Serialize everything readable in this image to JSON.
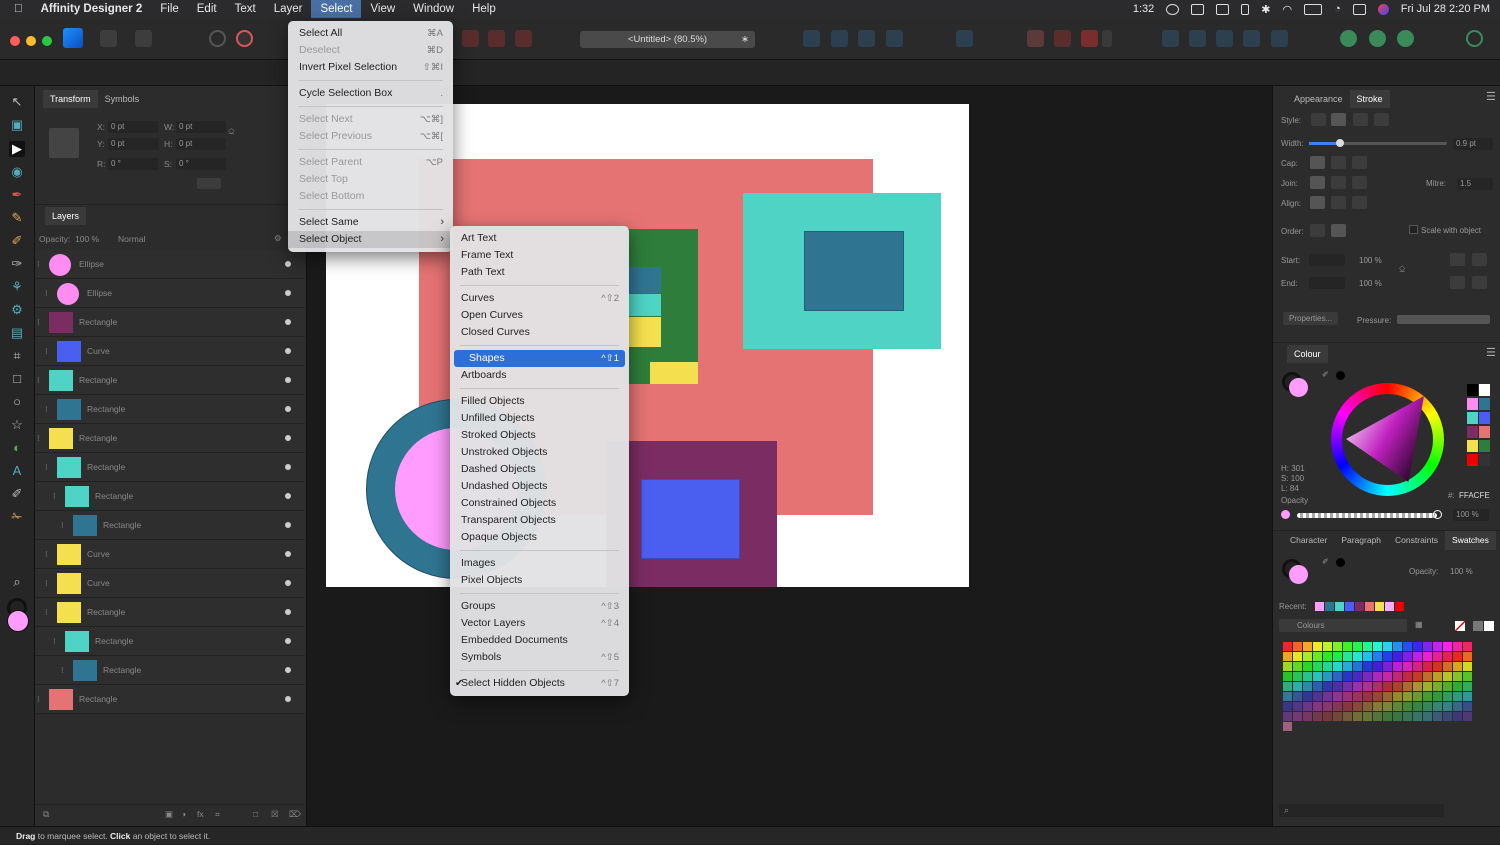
{
  "menubar": {
    "app_name": "Affinity Designer 2",
    "items": [
      "File",
      "Edit",
      "Text",
      "Layer",
      "Select",
      "View",
      "Window",
      "Help"
    ],
    "active": "Select",
    "status": {
      "battery_time": "1:32",
      "datetime": "Fri Jul 28  2:20 PM"
    }
  },
  "toolbar": {
    "document_tab": "<Untitled> (80.5%)"
  },
  "transform_panel": {
    "tabs": [
      "Transform",
      "Symbols"
    ],
    "x_label": "X:",
    "x_value": "0 pt",
    "y_label": "Y:",
    "y_value": "0 pt",
    "w_label": "W:",
    "w_value": "0 pt",
    "h_label": "H:",
    "h_value": "0 pt",
    "r_label": "R:",
    "r_value": "0 °",
    "s_label": "S:",
    "s_value": "0 °"
  },
  "layers_panel": {
    "title": "Layers",
    "opacity_label": "Opacity:",
    "opacity_value": "100 %",
    "blend_mode": "Normal",
    "rows": [
      {
        "name": "Ellipse",
        "color": "#ff8cf0",
        "shape": "circle"
      },
      {
        "name": "Ellipse",
        "color": "#ff8cf0",
        "shape": "circle"
      },
      {
        "name": "Rectangle",
        "color": "#7b2c62",
        "shape": "rect"
      },
      {
        "name": "Curve",
        "color": "#4a5ff0",
        "shape": "rect"
      },
      {
        "name": "Rectangle",
        "color": "#4ed3c4",
        "shape": "rect"
      },
      {
        "name": "Rectangle",
        "color": "#2f7592",
        "shape": "rect"
      },
      {
        "name": "Rectangle",
        "color": "#f4e04f",
        "shape": "rect"
      },
      {
        "name": "Rectangle",
        "color": "#4ed3c4",
        "shape": "rect"
      },
      {
        "name": "Rectangle",
        "color": "#4ed3c4",
        "shape": "rect"
      },
      {
        "name": "Rectangle",
        "color": "#2f7592",
        "shape": "rect"
      },
      {
        "name": "Curve",
        "color": "#f4e04f",
        "shape": "rect"
      },
      {
        "name": "Curve",
        "color": "#f4e04f",
        "shape": "rect"
      },
      {
        "name": "Rectangle",
        "color": "#f4e04f",
        "shape": "rect"
      },
      {
        "name": "Rectangle",
        "color": "#4ed3c4",
        "shape": "rect"
      },
      {
        "name": "Rectangle",
        "color": "#2f7592",
        "shape": "rect"
      },
      {
        "name": "Rectangle",
        "color": "#e57373",
        "shape": "rect"
      }
    ]
  },
  "select_menu": {
    "groups": [
      [
        {
          "label": "Select All",
          "shortcut": "⌘A",
          "disabled": false
        },
        {
          "label": "Deselect",
          "shortcut": "⌘D",
          "disabled": true
        },
        {
          "label": "Invert Pixel Selection",
          "shortcut": "⇧⌘I",
          "disabled": false
        }
      ],
      [
        {
          "label": "Cycle Selection Box",
          "shortcut": ".",
          "disabled": false
        }
      ],
      [
        {
          "label": "Select Next",
          "shortcut": "⌥⌘]",
          "disabled": true
        },
        {
          "label": "Select Previous",
          "shortcut": "⌥⌘[",
          "disabled": true
        }
      ],
      [
        {
          "label": "Select Parent",
          "shortcut": "⌥P",
          "disabled": true
        },
        {
          "label": "Select Top",
          "shortcut": "",
          "disabled": true
        },
        {
          "label": "Select Bottom",
          "shortcut": "",
          "disabled": true
        }
      ],
      [
        {
          "label": "Select Same",
          "shortcut": "",
          "disabled": false,
          "submenu": true
        },
        {
          "label": "Select Object",
          "shortcut": "",
          "disabled": false,
          "submenu": true,
          "open": true
        }
      ]
    ]
  },
  "select_object_submenu": {
    "groups": [
      [
        {
          "label": "Art Text",
          "shortcut": ""
        },
        {
          "label": "Frame Text",
          "shortcut": ""
        },
        {
          "label": "Path Text",
          "shortcut": ""
        }
      ],
      [
        {
          "label": "Curves",
          "shortcut": "^⇧2"
        },
        {
          "label": "Open Curves",
          "shortcut": ""
        },
        {
          "label": "Closed Curves",
          "shortcut": ""
        }
      ],
      [
        {
          "label": "Shapes",
          "shortcut": "^⇧1",
          "highlighted": true
        },
        {
          "label": "Artboards",
          "shortcut": ""
        }
      ],
      [
        {
          "label": "Filled Objects",
          "shortcut": ""
        },
        {
          "label": "Unfilled Objects",
          "shortcut": ""
        },
        {
          "label": "Stroked Objects",
          "shortcut": ""
        },
        {
          "label": "Unstroked Objects",
          "shortcut": ""
        },
        {
          "label": "Dashed Objects",
          "shortcut": ""
        },
        {
          "label": "Undashed Objects",
          "shortcut": ""
        },
        {
          "label": "Constrained Objects",
          "shortcut": ""
        },
        {
          "label": "Transparent Objects",
          "shortcut": ""
        },
        {
          "label": "Opaque Objects",
          "shortcut": ""
        }
      ],
      [
        {
          "label": "Images",
          "shortcut": ""
        },
        {
          "label": "Pixel Objects",
          "shortcut": ""
        }
      ],
      [
        {
          "label": "Groups",
          "shortcut": "^⇧3"
        },
        {
          "label": "Vector Layers",
          "shortcut": "^⇧4"
        },
        {
          "label": "Embedded Documents",
          "shortcut": ""
        },
        {
          "label": "Symbols",
          "shortcut": "^⇧5"
        }
      ],
      [
        {
          "label": "Select Hidden Objects",
          "shortcut": "^⇧7",
          "checked": true
        }
      ]
    ]
  },
  "stroke_panel": {
    "tabs": [
      "Appearance",
      "Stroke"
    ],
    "style_label": "Style:",
    "width_label": "Width:",
    "width_value": "0.9 pt",
    "cap_label": "Cap:",
    "join_label": "Join:",
    "mitre_label": "Mitre:",
    "mitre_value": "1.5",
    "align_label": "Align:",
    "order_label": "Order:",
    "scale_label": "Scale with object",
    "start_label": "Start:",
    "end_label": "End:",
    "start_pct": "100 %",
    "end_pct": "100 %",
    "properties_btn": "Properties...",
    "pressure_label": "Pressure:"
  },
  "colour_panel": {
    "title": "Colour",
    "h": "H: 301",
    "s": "S: 100",
    "l": "L: 84",
    "opacity_label": "Opacity",
    "hex_label": "#:",
    "hex_value": "FFACFE",
    "opacity_value": "100 %",
    "fill_color": "#ff9cfe"
  },
  "swatches_panel": {
    "tabs": [
      "Character",
      "Paragraph",
      "Constraints",
      "Swatches"
    ],
    "opacity_label": "Opacity:",
    "opacity_value": "100 %",
    "recent_label": "Recent:",
    "palette_name": "Colours"
  },
  "statusbar": {
    "drag": "Drag",
    "t1": " to marquee select. ",
    "click": "Click",
    "t2": " an object to select it."
  }
}
